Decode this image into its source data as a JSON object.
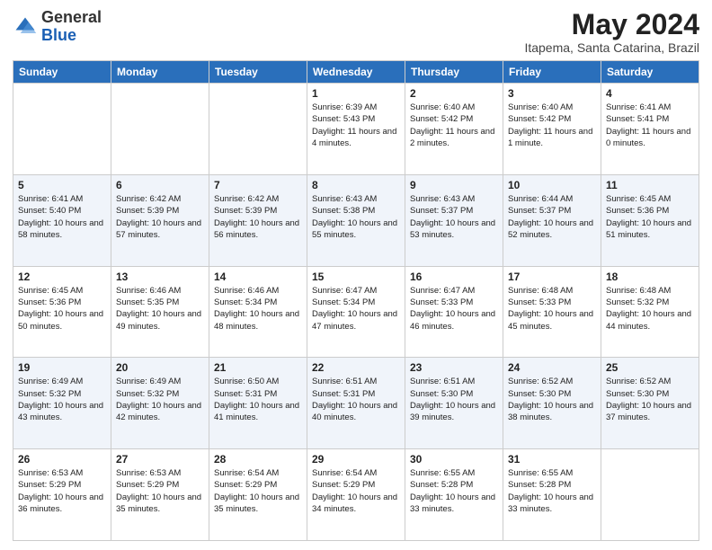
{
  "header": {
    "logo_general": "General",
    "logo_blue": "Blue",
    "title": "May 2024",
    "subtitle": "Itapema, Santa Catarina, Brazil"
  },
  "columns": [
    "Sunday",
    "Monday",
    "Tuesday",
    "Wednesday",
    "Thursday",
    "Friday",
    "Saturday"
  ],
  "weeks": [
    [
      {
        "day": "",
        "sunrise": "",
        "sunset": "",
        "daylight": ""
      },
      {
        "day": "",
        "sunrise": "",
        "sunset": "",
        "daylight": ""
      },
      {
        "day": "",
        "sunrise": "",
        "sunset": "",
        "daylight": ""
      },
      {
        "day": "1",
        "sunrise": "Sunrise: 6:39 AM",
        "sunset": "Sunset: 5:43 PM",
        "daylight": "Daylight: 11 hours and 4 minutes."
      },
      {
        "day": "2",
        "sunrise": "Sunrise: 6:40 AM",
        "sunset": "Sunset: 5:42 PM",
        "daylight": "Daylight: 11 hours and 2 minutes."
      },
      {
        "day": "3",
        "sunrise": "Sunrise: 6:40 AM",
        "sunset": "Sunset: 5:42 PM",
        "daylight": "Daylight: 11 hours and 1 minute."
      },
      {
        "day": "4",
        "sunrise": "Sunrise: 6:41 AM",
        "sunset": "Sunset: 5:41 PM",
        "daylight": "Daylight: 11 hours and 0 minutes."
      }
    ],
    [
      {
        "day": "5",
        "sunrise": "Sunrise: 6:41 AM",
        "sunset": "Sunset: 5:40 PM",
        "daylight": "Daylight: 10 hours and 58 minutes."
      },
      {
        "day": "6",
        "sunrise": "Sunrise: 6:42 AM",
        "sunset": "Sunset: 5:39 PM",
        "daylight": "Daylight: 10 hours and 57 minutes."
      },
      {
        "day": "7",
        "sunrise": "Sunrise: 6:42 AM",
        "sunset": "Sunset: 5:39 PM",
        "daylight": "Daylight: 10 hours and 56 minutes."
      },
      {
        "day": "8",
        "sunrise": "Sunrise: 6:43 AM",
        "sunset": "Sunset: 5:38 PM",
        "daylight": "Daylight: 10 hours and 55 minutes."
      },
      {
        "day": "9",
        "sunrise": "Sunrise: 6:43 AM",
        "sunset": "Sunset: 5:37 PM",
        "daylight": "Daylight: 10 hours and 53 minutes."
      },
      {
        "day": "10",
        "sunrise": "Sunrise: 6:44 AM",
        "sunset": "Sunset: 5:37 PM",
        "daylight": "Daylight: 10 hours and 52 minutes."
      },
      {
        "day": "11",
        "sunrise": "Sunrise: 6:45 AM",
        "sunset": "Sunset: 5:36 PM",
        "daylight": "Daylight: 10 hours and 51 minutes."
      }
    ],
    [
      {
        "day": "12",
        "sunrise": "Sunrise: 6:45 AM",
        "sunset": "Sunset: 5:36 PM",
        "daylight": "Daylight: 10 hours and 50 minutes."
      },
      {
        "day": "13",
        "sunrise": "Sunrise: 6:46 AM",
        "sunset": "Sunset: 5:35 PM",
        "daylight": "Daylight: 10 hours and 49 minutes."
      },
      {
        "day": "14",
        "sunrise": "Sunrise: 6:46 AM",
        "sunset": "Sunset: 5:34 PM",
        "daylight": "Daylight: 10 hours and 48 minutes."
      },
      {
        "day": "15",
        "sunrise": "Sunrise: 6:47 AM",
        "sunset": "Sunset: 5:34 PM",
        "daylight": "Daylight: 10 hours and 47 minutes."
      },
      {
        "day": "16",
        "sunrise": "Sunrise: 6:47 AM",
        "sunset": "Sunset: 5:33 PM",
        "daylight": "Daylight: 10 hours and 46 minutes."
      },
      {
        "day": "17",
        "sunrise": "Sunrise: 6:48 AM",
        "sunset": "Sunset: 5:33 PM",
        "daylight": "Daylight: 10 hours and 45 minutes."
      },
      {
        "day": "18",
        "sunrise": "Sunrise: 6:48 AM",
        "sunset": "Sunset: 5:32 PM",
        "daylight": "Daylight: 10 hours and 44 minutes."
      }
    ],
    [
      {
        "day": "19",
        "sunrise": "Sunrise: 6:49 AM",
        "sunset": "Sunset: 5:32 PM",
        "daylight": "Daylight: 10 hours and 43 minutes."
      },
      {
        "day": "20",
        "sunrise": "Sunrise: 6:49 AM",
        "sunset": "Sunset: 5:32 PM",
        "daylight": "Daylight: 10 hours and 42 minutes."
      },
      {
        "day": "21",
        "sunrise": "Sunrise: 6:50 AM",
        "sunset": "Sunset: 5:31 PM",
        "daylight": "Daylight: 10 hours and 41 minutes."
      },
      {
        "day": "22",
        "sunrise": "Sunrise: 6:51 AM",
        "sunset": "Sunset: 5:31 PM",
        "daylight": "Daylight: 10 hours and 40 minutes."
      },
      {
        "day": "23",
        "sunrise": "Sunrise: 6:51 AM",
        "sunset": "Sunset: 5:30 PM",
        "daylight": "Daylight: 10 hours and 39 minutes."
      },
      {
        "day": "24",
        "sunrise": "Sunrise: 6:52 AM",
        "sunset": "Sunset: 5:30 PM",
        "daylight": "Daylight: 10 hours and 38 minutes."
      },
      {
        "day": "25",
        "sunrise": "Sunrise: 6:52 AM",
        "sunset": "Sunset: 5:30 PM",
        "daylight": "Daylight: 10 hours and 37 minutes."
      }
    ],
    [
      {
        "day": "26",
        "sunrise": "Sunrise: 6:53 AM",
        "sunset": "Sunset: 5:29 PM",
        "daylight": "Daylight: 10 hours and 36 minutes."
      },
      {
        "day": "27",
        "sunrise": "Sunrise: 6:53 AM",
        "sunset": "Sunset: 5:29 PM",
        "daylight": "Daylight: 10 hours and 35 minutes."
      },
      {
        "day": "28",
        "sunrise": "Sunrise: 6:54 AM",
        "sunset": "Sunset: 5:29 PM",
        "daylight": "Daylight: 10 hours and 35 minutes."
      },
      {
        "day": "29",
        "sunrise": "Sunrise: 6:54 AM",
        "sunset": "Sunset: 5:29 PM",
        "daylight": "Daylight: 10 hours and 34 minutes."
      },
      {
        "day": "30",
        "sunrise": "Sunrise: 6:55 AM",
        "sunset": "Sunset: 5:28 PM",
        "daylight": "Daylight: 10 hours and 33 minutes."
      },
      {
        "day": "31",
        "sunrise": "Sunrise: 6:55 AM",
        "sunset": "Sunset: 5:28 PM",
        "daylight": "Daylight: 10 hours and 33 minutes."
      },
      {
        "day": "",
        "sunrise": "",
        "sunset": "",
        "daylight": ""
      }
    ]
  ]
}
